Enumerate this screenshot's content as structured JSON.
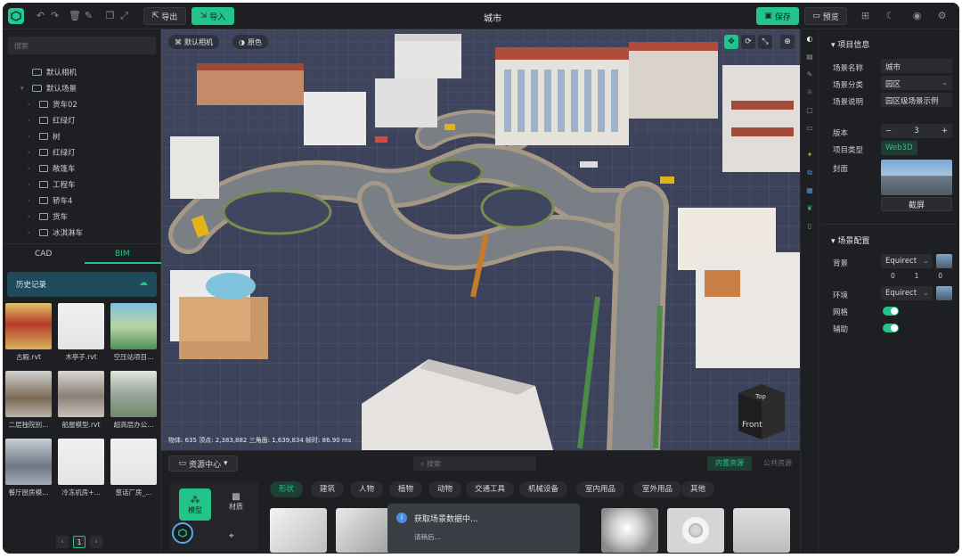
{
  "topbar": {
    "export_label": "导出",
    "import_label": "导入",
    "title": "城市",
    "save_label": "保存",
    "preview_label": "预览"
  },
  "left": {
    "search_placeholder": "搜索",
    "tree": [
      {
        "label": "默认相机",
        "type": "camera"
      },
      {
        "label": "默认场景",
        "type": "scene"
      },
      {
        "label": "货车02",
        "type": "folder"
      },
      {
        "label": "红绿灯",
        "type": "folder"
      },
      {
        "label": "树",
        "type": "folder"
      },
      {
        "label": "红绿灯",
        "type": "folder"
      },
      {
        "label": "敞篷车",
        "type": "folder"
      },
      {
        "label": "工程车",
        "type": "folder"
      },
      {
        "label": "轿车4",
        "type": "folder"
      },
      {
        "label": "货车",
        "type": "folder"
      },
      {
        "label": "冰淇淋车",
        "type": "folder"
      }
    ],
    "tab_cad": "CAD",
    "tab_bim": "BIM",
    "history_label": "历史记录",
    "thumbs": [
      {
        "label": "古殿.rvt"
      },
      {
        "label": "木亭子.rvt"
      },
      {
        "label": "空压站项目..."
      },
      {
        "label": "二层独院别..."
      },
      {
        "label": "船屋模型.rvt"
      },
      {
        "label": "超高层办公..."
      },
      {
        "label": "餐厅厨房模..."
      },
      {
        "label": "冷冻机房+..."
      },
      {
        "label": "葱话厂房_..."
      }
    ],
    "page": "1"
  },
  "viewport": {
    "camera_label": "默认相机",
    "color_label": "原色",
    "stats": "物体: 635 顶点: 2,383,882 三角面: 1,639,834 帧时: 86.90 ms",
    "cube_top": "Top",
    "cube_front": "Front"
  },
  "bottom": {
    "resource_center": "资源中心",
    "search_placeholder": "搜索",
    "builtin_tab": "内置资源",
    "public_tab": "公共资源",
    "side_model": "模型",
    "side_material": "材质",
    "categories": [
      "形状",
      "建筑",
      "人物",
      "植物",
      "动物",
      "交通工具",
      "机械设备",
      "室内用品",
      "室外用品",
      "其他"
    ]
  },
  "toast": {
    "title": "获取场景数据中...",
    "subtitle": "请稍后..."
  },
  "right": {
    "section_info": "项目信息",
    "scene_name_label": "场景名称",
    "scene_name_value": "城市",
    "scene_cat_label": "场景分类",
    "scene_cat_value": "园区",
    "scene_desc_label": "场景说明",
    "scene_desc_value": "园区级场景示例",
    "version_label": "版本",
    "version_value": "3",
    "type_label": "项目类型",
    "type_value": "Web3D",
    "cover_label": "封面",
    "screenshot_label": "截屏",
    "section_config": "场景配置",
    "bg_label": "背景",
    "bg_value": "Equirect",
    "bg_nums": [
      "0",
      "1",
      "0"
    ],
    "env_label": "环境",
    "env_value": "Equirect",
    "grid_label": "网格",
    "aux_label": "辅助"
  },
  "colors": {
    "accent": "#23c489",
    "bg": "#1b1c1f",
    "panel": "#1e1f22"
  }
}
